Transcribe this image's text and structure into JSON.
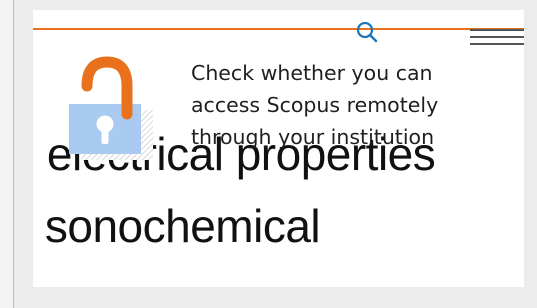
{
  "header": {
    "search_icon": "search-icon",
    "menu_icon": "hamburger-menu-icon",
    "accent_color": "#e9711c"
  },
  "article": {
    "title_lines": [
      "n I electrical properties",
      "by sonochemical"
    ]
  },
  "remote_access": {
    "icon": "unlocked-padlock-icon",
    "lines": [
      "Check whether you can",
      "access Scopus remotely",
      "through your institution"
    ],
    "lock_shackle_color": "#e9711c",
    "lock_body_color": "#a9cbf1"
  }
}
